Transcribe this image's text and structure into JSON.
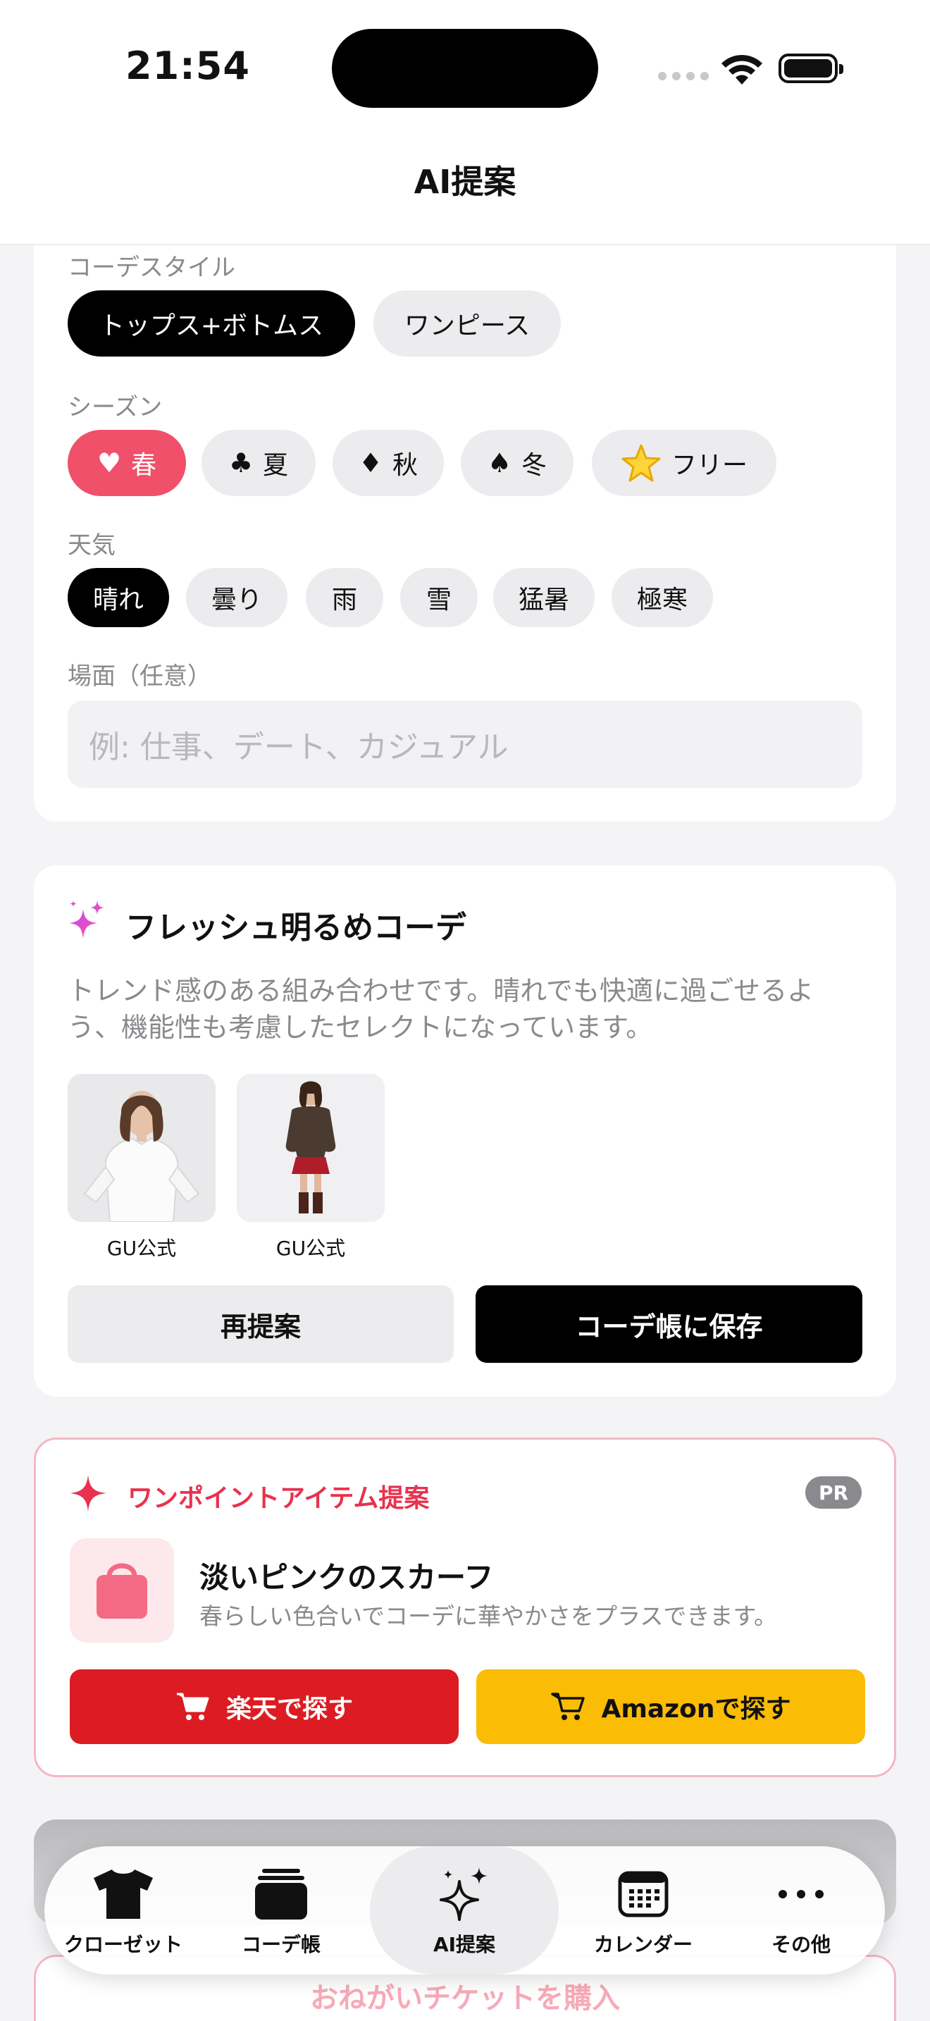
{
  "status": {
    "time": "21:54"
  },
  "header": {
    "title": "AI提案"
  },
  "filters": {
    "style_label": "コーデスタイル",
    "styles": [
      "トップス+ボトムス",
      "ワンピース"
    ],
    "season_label": "シーズン",
    "seasons": [
      {
        "label": "春",
        "icon": "heart-icon"
      },
      {
        "label": "夏",
        "icon": "club-icon"
      },
      {
        "label": "秋",
        "icon": "diamond-icon"
      },
      {
        "label": "冬",
        "icon": "spade-icon"
      },
      {
        "label": "フリー",
        "icon": "star-icon"
      }
    ],
    "weather_label": "天気",
    "weathers": [
      "晴れ",
      "曇り",
      "雨",
      "雪",
      "猛暑",
      "極寒"
    ],
    "scene_label": "場面（任意）",
    "scene_placeholder": "例: 仕事、デート、カジュアル",
    "colors": {
      "selected_black": "#000000",
      "season_selected": "#f0506a"
    }
  },
  "outfit": {
    "title": "フレッシュ明るめコーデ",
    "description": "トレンド感のある組み合わせです。晴れでも快適に過ごせるよう、機能性も考慮したセレクトになっています。",
    "items": [
      {
        "caption": "GU公式"
      },
      {
        "caption": "GU公式"
      }
    ],
    "regenerate_label": "再提案",
    "save_label": "コーデ帳に保存"
  },
  "pr": {
    "title": "ワンポイントアイテム提案",
    "badge": "PR",
    "item_name": "淡いピンクのスカーフ",
    "item_desc": "春らしい色合いでコーデに華やかさをプラスできます。",
    "rakuten_label": "楽天で探す",
    "amazon_label": "Amazonで探す",
    "colors": {
      "accent": "#e8324e",
      "rakuten": "#dc1c22",
      "amazon": "#fbbc05"
    }
  },
  "behind": {
    "ticket_label": "おねがいチケットを購入"
  },
  "tabbar": {
    "tabs": [
      {
        "label": "クローゼット",
        "icon": "tshirt-icon"
      },
      {
        "label": "コーデ帳",
        "icon": "stack-icon"
      },
      {
        "label": "AI提案",
        "icon": "sparkles-icon"
      },
      {
        "label": "カレンダー",
        "icon": "calendar-icon"
      },
      {
        "label": "その他",
        "icon": "more-icon"
      }
    ],
    "active": "AI提案"
  }
}
